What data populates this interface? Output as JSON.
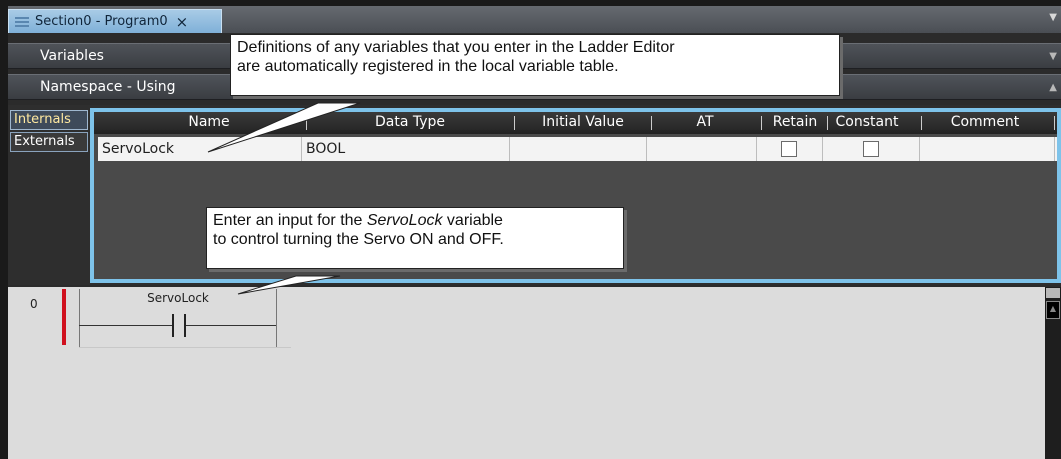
{
  "document_tab": {
    "title": "Section0 - Program0",
    "close_glyph": "×"
  },
  "panels": {
    "variables_label": "Variables",
    "namespace_label": "Namespace - Using"
  },
  "side_tabs": {
    "internals": "Internals",
    "externals": "Externals"
  },
  "table": {
    "headers": {
      "name": "Name",
      "data_type": "Data Type",
      "initial_value": "Initial Value",
      "at": "AT",
      "retain": "Retain",
      "constant": "Constant",
      "comment": "Comment"
    },
    "rows": [
      {
        "name": "ServoLock",
        "data_type": "BOOL",
        "initial_value": "",
        "at": "",
        "retain": false,
        "constant": false,
        "comment": ""
      }
    ]
  },
  "ladder": {
    "rung_number": "0",
    "contact_variable": "ServoLock"
  },
  "callouts": {
    "top_line1": "Definitions of any variables that you enter in the Ladder Editor",
    "top_line2": "are automatically registered in the local variable table.",
    "bottom_line1_prefix": "Enter an input for the ",
    "bottom_line1_var": "ServoLock",
    "bottom_line1_suffix": " variable",
    "bottom_line2": "to control turning the Servo ON and OFF."
  },
  "colors": {
    "accent_table_border": "#7ec3ea",
    "active_tab": "#7fb0d8",
    "rung_marker": "#d0101e"
  }
}
